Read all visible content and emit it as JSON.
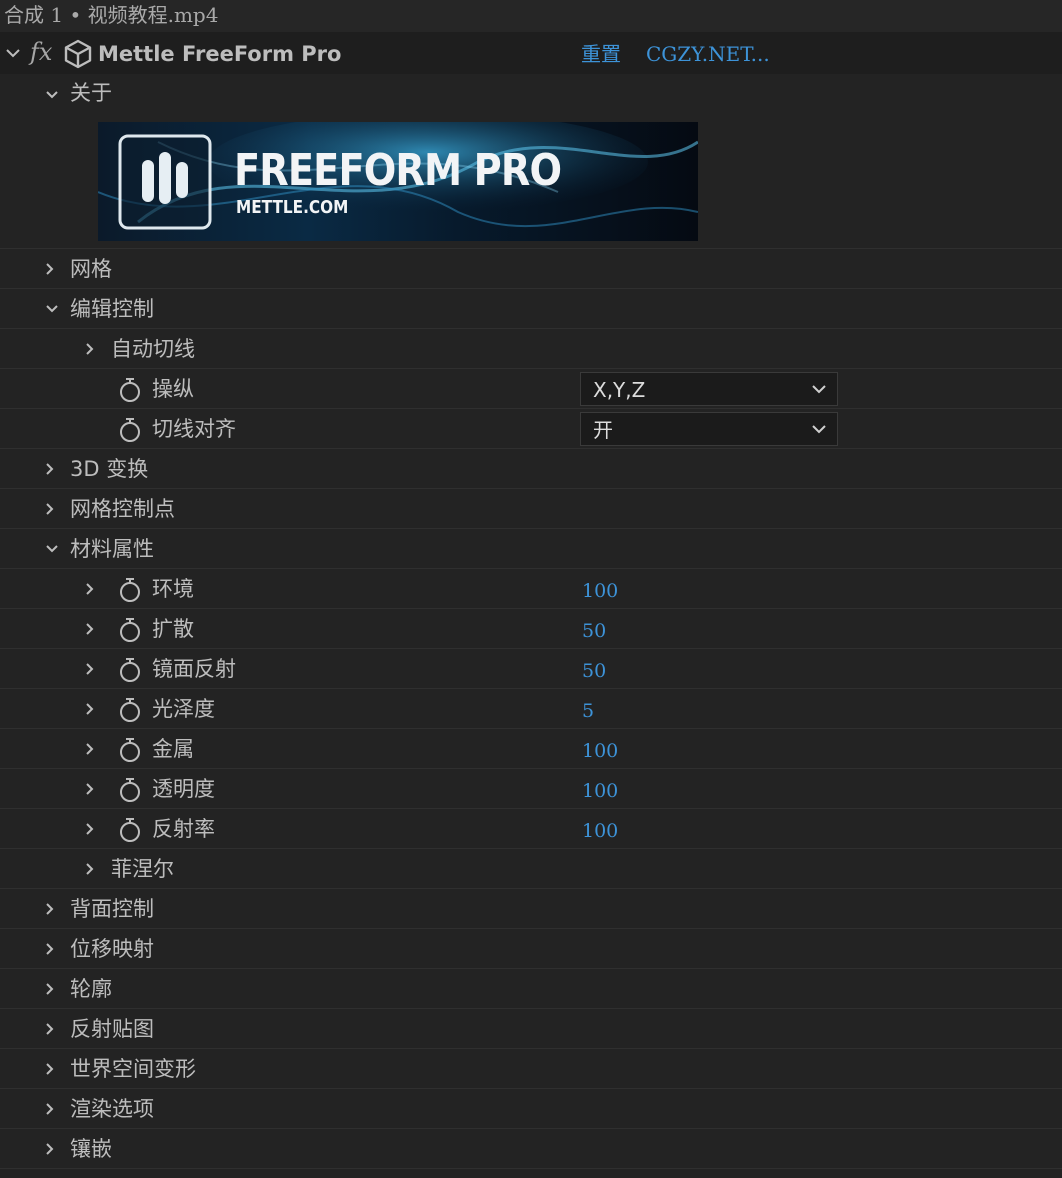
{
  "title": "合成 1 • 视频教程.mp4",
  "effect": {
    "fx_label": "fx",
    "name": "Mettle FreeForm Pro",
    "reset": "重置",
    "about_link": "CGZY.NET..."
  },
  "about": {
    "label": "关于",
    "banner_title": "FREEFORM PRO",
    "banner_sub": "METTLE.COM"
  },
  "rows": {
    "mesh": "网格",
    "edit_controls": "编辑控制",
    "auto_tangent": "自动切线",
    "manipulate": {
      "label": "操纵",
      "value": "X,Y,Z"
    },
    "tangent_align": {
      "label": "切线对齐",
      "value": "开"
    },
    "transform3d": "3D 变换",
    "mesh_points": "网格控制点",
    "material": "材料属性",
    "ambient": {
      "label": "环境",
      "value": "100"
    },
    "diffuse": {
      "label": "扩散",
      "value": "50"
    },
    "specular": {
      "label": "镜面反射",
      "value": "50"
    },
    "gloss": {
      "label": "光泽度",
      "value": "5"
    },
    "metal": {
      "label": "金属",
      "value": "100"
    },
    "transparency": {
      "label": "透明度",
      "value": "100"
    },
    "reflectivity": {
      "label": "反射率",
      "value": "100"
    },
    "fresnel": "菲涅尔",
    "backface": "背面控制",
    "displacement": "位移映射",
    "outline": "轮廓",
    "reflection_map": "反射贴图",
    "world_deform": "世界空间变形",
    "render_options": "渲染选项",
    "inlay": "镶嵌"
  },
  "colors": {
    "link": "#3d93d8",
    "panel": "#232323",
    "header": "#1e1e1e"
  }
}
